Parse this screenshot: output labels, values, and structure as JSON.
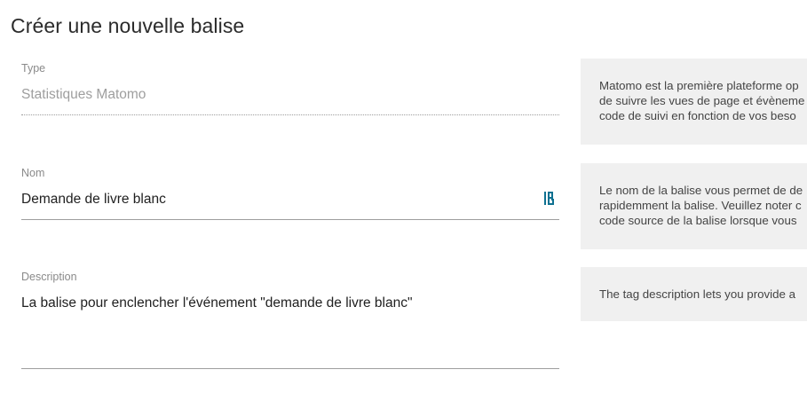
{
  "page": {
    "title": "Créer une nouvelle balise"
  },
  "fields": {
    "type": {
      "label": "Type",
      "value": "Statistiques Matomo"
    },
    "name": {
      "label": "Nom",
      "value": "Demande de livre blanc",
      "icon": "password-manager-icon"
    },
    "description": {
      "label": "Description",
      "value": "La balise pour enclencher l'événement \"demande de livre blanc\""
    }
  },
  "help": {
    "type": "Matomo est la première plateforme op\nde suivre les vues de page et évèneme\ncode de suivi en fonction de vos beso",
    "name": "Le nom de la balise vous permet de de\nrapidemment la balise. Veuillez noter c\ncode source de la balise lorsque vous",
    "description": "The tag description lets you provide a"
  },
  "colors": {
    "accent_icon": "#0f7191",
    "help_background": "#f0f0f0",
    "underline": "#9e9e9e"
  }
}
